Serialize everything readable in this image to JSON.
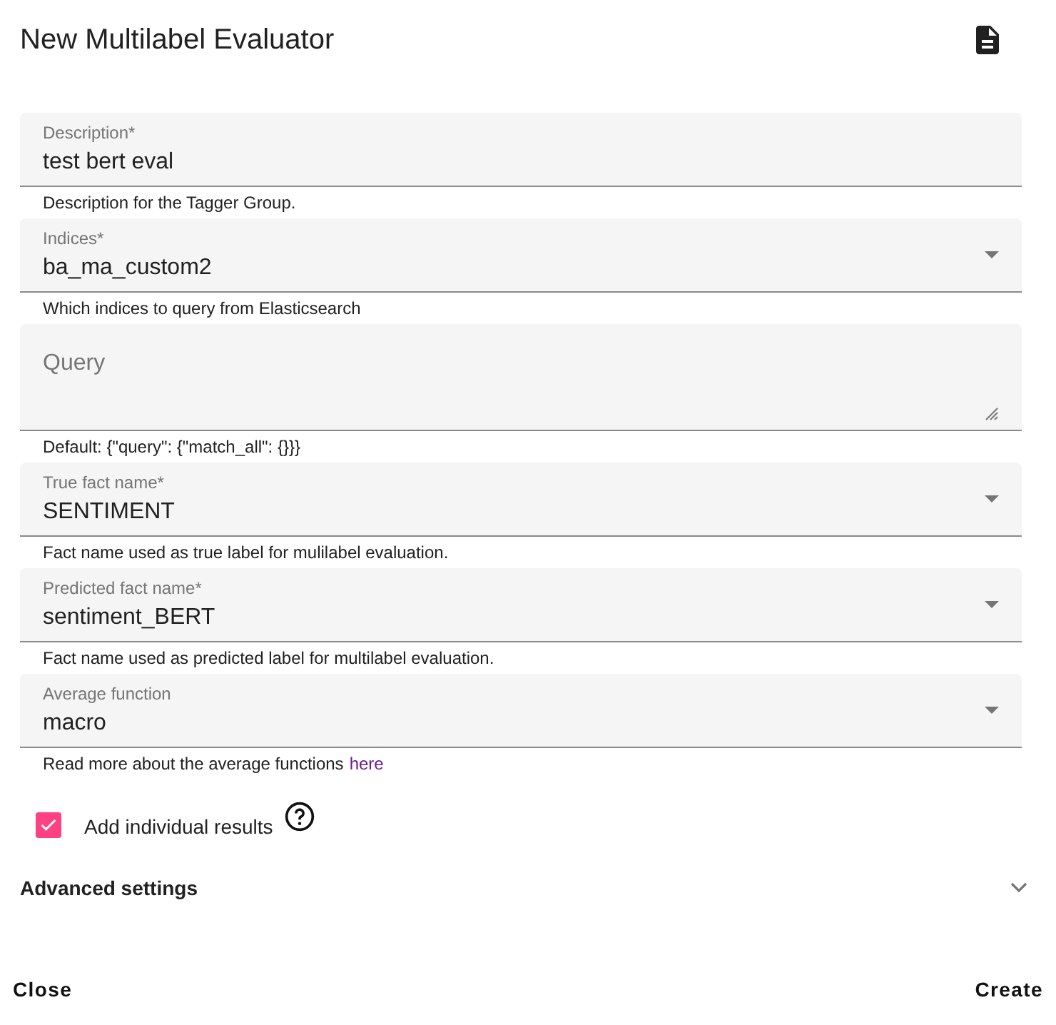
{
  "dialog": {
    "title": "New Multilabel Evaluator"
  },
  "fields": [
    {
      "kind": "input",
      "label": "Description*",
      "value": "test bert eval",
      "hint": "Description for the Tagger Group."
    },
    {
      "kind": "select",
      "label": "Indices*",
      "value": "ba_ma_custom2",
      "hint": "Which indices to query from Elasticsearch"
    },
    {
      "kind": "textarea",
      "placeholder": "Query",
      "hint": "Default: {\"query\": {\"match_all\": {}}}"
    },
    {
      "kind": "select",
      "label": "True fact name*",
      "value": "SENTIMENT",
      "hint": "Fact name used as true label for mulilabel evaluation."
    },
    {
      "kind": "select",
      "label": "Predicted fact name*",
      "value": "sentiment_BERT",
      "hint": "Fact name used as predicted label for multilabel evaluation."
    },
    {
      "kind": "select",
      "label": "Average function",
      "value": "macro",
      "hint": "Read more about the average functions",
      "hint_link": "here"
    }
  ],
  "checkbox": {
    "label": "Add individual results",
    "checked": true
  },
  "advanced": {
    "label": "Advanced settings",
    "expanded": false
  },
  "buttons": [
    "Close",
    "Create"
  ]
}
